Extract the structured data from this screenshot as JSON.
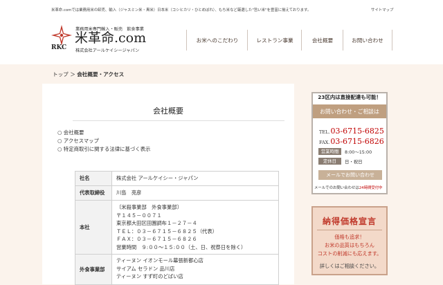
{
  "header": {
    "tagline": "米革命.comでは業務用米の卸売、輸入（ジャスミン米・黒米）日本米（コシヒカリ・ひとめぼれ）、もち米など厳選した\"旨い米\"を豊富に揃えております。",
    "sitemap": "サイトマップ",
    "logo_sub": "業務用米専門輸入・販売　飲食事業",
    "logo_title": "米革命.com",
    "logo_rkc": "RKC",
    "logo_company": "株式会社アールケイシージャパン",
    "nav": [
      "お米へのこだわり",
      "レストラン事業",
      "会社概要",
      "お問い合わせ"
    ]
  },
  "breadcrumb": {
    "home": "トップ",
    "sep": "＞",
    "current": "会社概要・アクセス"
  },
  "main": {
    "title": "会社概要",
    "toc": [
      "○ 会社概要",
      "○ アクセスマップ",
      "○ 特定商取引に関する法律に基づく表示"
    ],
    "table": {
      "name_label": "社名",
      "name_value": "株式会社 アールケイシー・ジャパン",
      "ceo_label": "代表取締役",
      "ceo_value": "川島　亮彦",
      "hq_label": "本社",
      "hq_lines": [
        "〔米殺事業部　外食事業部〕",
        "〒１４５－００７１",
        "東京都大田区田園調布１－２７－４",
        "ＴＥＬ：０３－６７１５－６８２５（代表）",
        "ＦＡＸ：０３－６７１５－６８２６",
        "営業時間　９:００～１５:００（土、日、祝祭日を除く）"
      ],
      "restaurant_label": "外食事業部",
      "restaurant_lines": [
        "ティーヌン イオンモール幕張新都心店",
        "サイアム セラドン 品川店",
        "ティーヌン すず町のどばい店"
      ]
    }
  },
  "sidebar": {
    "area": "23区内は直接配達も可能！",
    "contact_header": "お問い合わせ・ご相談は",
    "tel_label": "TEL.",
    "tel": "03-6715-6825",
    "fax_label": "FAX.",
    "fax": "03-6715-6826",
    "hours_label": "営業時間",
    "hours": "8:00～15:00",
    "holiday_label": "定休日",
    "holiday": "日・祝日",
    "mail_button": "メールでお問い合わせ",
    "mail_note_a": "メールでのお問い合わせは",
    "mail_note_b": "24時間受付中",
    "promo_title": "納得価格宣言",
    "promo_lines": [
      "価格も追求！",
      "お米の品質はもちろん",
      "コストの削減にも応えます。",
      "詳しくはご相談ください。"
    ]
  },
  "colors": {
    "accent_red": "#c00000",
    "sidebar_brown": "#bf9f80",
    "promo_bg": "#f3d9c9"
  }
}
